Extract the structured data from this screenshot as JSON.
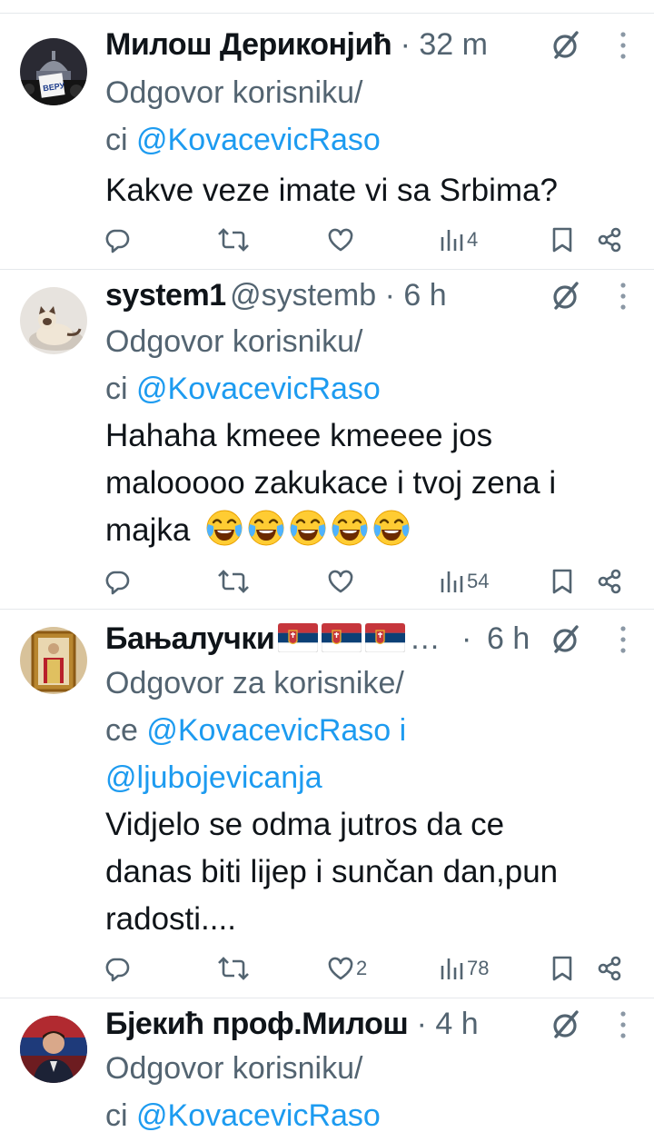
{
  "tweets": [
    {
      "name": "Милош Дериконјић",
      "handle": "",
      "time": "32 m",
      "reply_prefix": "Odgovor korisniku/",
      "reply_line2_prefix": "ci ",
      "mentions": [
        "@KovacevicRaso"
      ],
      "text_lines": [
        "Kakve veze imate vi sa Srbima?"
      ],
      "replies": "",
      "retweets": "",
      "likes": "",
      "views": "4"
    },
    {
      "name": "system1",
      "handle": "@systemb",
      "time": "6 h",
      "reply_prefix": "Odgovor korisniku/",
      "reply_line2_prefix": "ci ",
      "mentions": [
        "@KovacevicRaso"
      ],
      "text_lines": [
        "Hahaha kmeee kmeeee jos",
        "malooooo zakukace i tvoj zena i",
        "majka"
      ],
      "emoji_count": 5,
      "replies": "",
      "retweets": "",
      "likes": "",
      "views": "54"
    },
    {
      "name": "Бањалучки",
      "handle": "…",
      "time": "6 h",
      "flags": 3,
      "reply_prefix": "Odgovor za korisnike/",
      "reply_line2_prefix": "ce ",
      "mentions": [
        "@KovacevicRaso",
        "@ljubojevicanja"
      ],
      "mention_joiner": " i",
      "text_lines": [
        "Vidjelo se odma jutros da ce",
        "danas biti lijep i sunčan dan,pun",
        "radosti...."
      ],
      "replies": "",
      "retweets": "",
      "likes": "2",
      "views": "78"
    },
    {
      "name": "Бјекић проф.Милош",
      "handle": "",
      "time": "4 h",
      "reply_prefix": "Odgovor korisniku/",
      "reply_line2_prefix": "ci ",
      "mentions": [
        "@KovacevicRaso"
      ]
    }
  ],
  "avatar_text": "ВЕРУ",
  "icons": [
    "grok-icon",
    "more-icon",
    "reply-icon",
    "retweet-icon",
    "like-icon",
    "views-icon",
    "bookmark-icon",
    "share-icon",
    "laughing-emoji",
    "serbia-flag"
  ],
  "colors": {
    "text": "#0f1419",
    "secondary": "#536471",
    "link": "#1d9bf0",
    "divider": "#e5e8eb"
  }
}
